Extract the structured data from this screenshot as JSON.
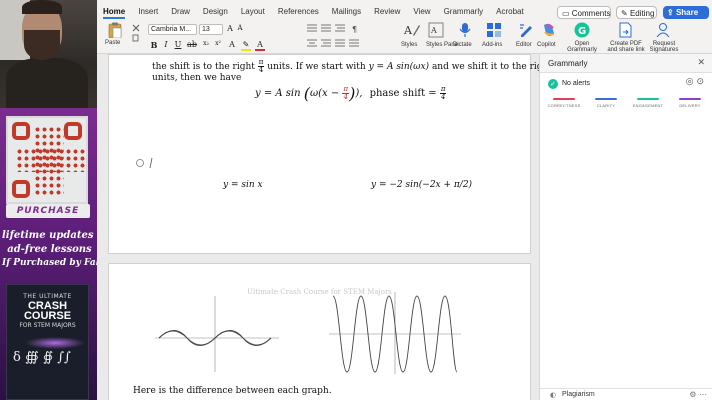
{
  "ribbon": {
    "tabs": [
      "Home",
      "Insert",
      "Draw",
      "Design",
      "Layout",
      "References",
      "Mailings",
      "Review",
      "View",
      "Grammarly",
      "Acrobat"
    ],
    "comments_label": "Comments",
    "editing_label": "Editing",
    "share_label": "Share",
    "paste_label": "Paste",
    "font_name": "Cambria M...",
    "font_size": "13",
    "styles_label": "Styles",
    "styles_pane_label": "Styles Pane",
    "dictate_label": "Dictate",
    "addins_label": "Add-ins",
    "editor_label": "Editor",
    "copilot_label": "Copilot",
    "open_grammarly_label": "Open Grammarly",
    "create_pdf_label": "Create PDF and share link",
    "request_signatures_label": "Request Signatures",
    "accent_color": "#2b6cd6"
  },
  "promo": {
    "badge_text": "PURCHASE",
    "line1": "lifetime updates with",
    "line2": "ad-free lessons",
    "line3": "If Purchased by Fall",
    "book_top": "THE ULTIMATE",
    "book_title": "CRASH COURSE",
    "book_sub": "FOR STEM MAJORS",
    "book_symbols": "δ  ∰  ∯  ∫∫"
  },
  "document": {
    "page1": {
      "line1_a": "the shift is to the right",
      "line1_b": "units. If we start with",
      "line1_math": "y = A sin(ωx)",
      "line1_c": "and we shift it to the right",
      "frac_num": "π",
      "frac_den": "4",
      "line2": "units, then we have",
      "eq_left": "y = A sin",
      "eq_inner": "ω(x −",
      "eq_right": "),",
      "phase_label": "phase shift =",
      "graph1_label": "y = sin x",
      "graph2_label": "y = −2 sin(−2x + π/2)"
    },
    "page2": {
      "watermark": "Ultimate Crash Course for STEM Majors",
      "caption": "Here is the difference between each graph."
    }
  },
  "grammarly": {
    "pane_title": "Grammarly",
    "alerts_label": "No alerts",
    "categories": [
      {
        "name": "CORRECTNESS",
        "color": "#e0405a"
      },
      {
        "name": "CLARITY",
        "color": "#3b6fd8"
      },
      {
        "name": "ENGAGEMENT",
        "color": "#15c39a"
      },
      {
        "name": "DELIVERY",
        "color": "#8b3fd1"
      }
    ],
    "plagiarism_label": "Plagiarism"
  }
}
